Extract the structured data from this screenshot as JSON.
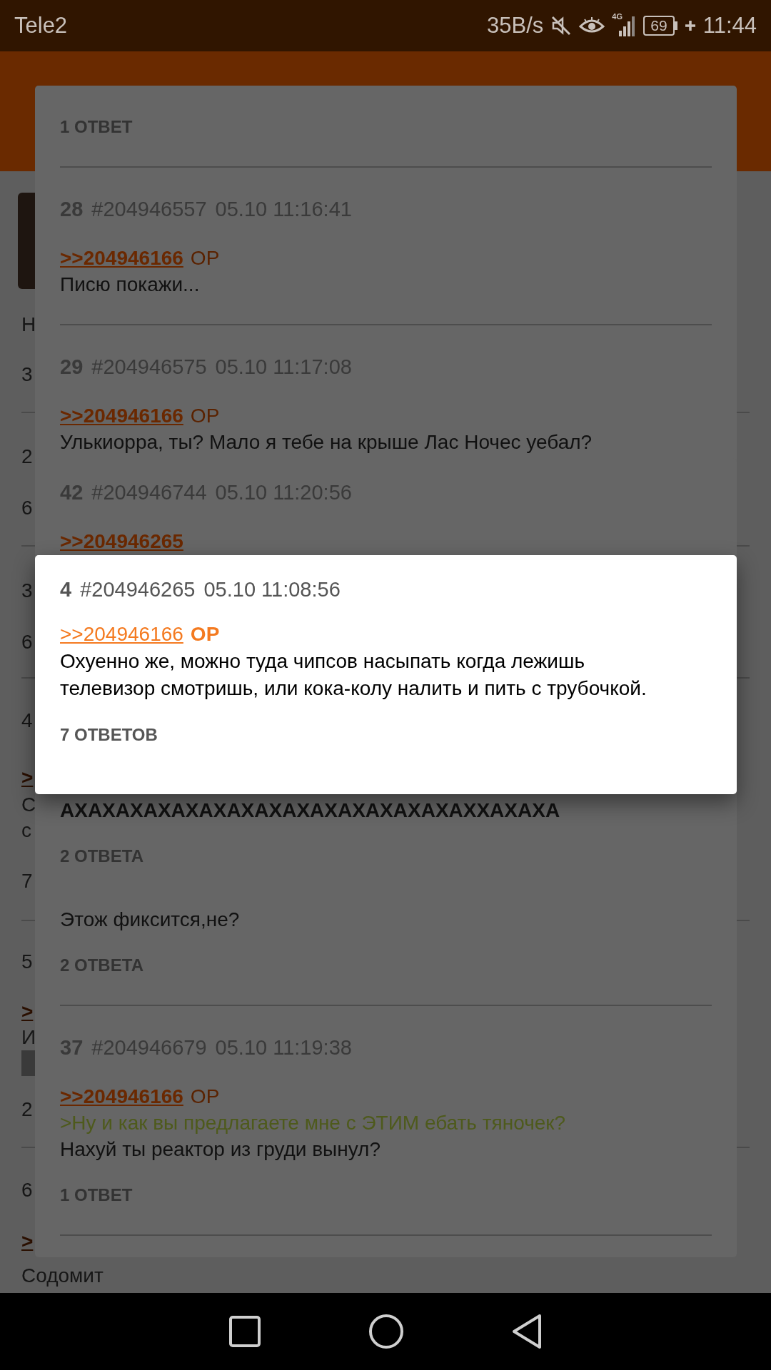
{
  "status_bar": {
    "carrier": "Tele2",
    "net_speed": "35B/s",
    "network": "4G",
    "battery": "69",
    "time": "11:44"
  },
  "background": {
    "rows": [
      {
        "kind": "thumbnail"
      },
      {
        "kind": "text",
        "text": "Н"
      },
      {
        "kind": "text",
        "text": "3"
      },
      {
        "kind": "divider"
      },
      {
        "kind": "text",
        "text": "2"
      },
      {
        "kind": "text",
        "text": "6"
      },
      {
        "kind": "divider"
      },
      {
        "kind": "text",
        "text": "3"
      },
      {
        "kind": "text",
        "text": "6"
      },
      {
        "kind": "divider"
      },
      {
        "kind": "text",
        "text": "4"
      },
      {
        "kind": "link",
        "text": ">"
      },
      {
        "kind": "text",
        "text": "С"
      },
      {
        "kind": "text",
        "text": "с"
      },
      {
        "kind": "text",
        "text": "7"
      },
      {
        "kind": "divider"
      },
      {
        "kind": "text",
        "text": "5"
      },
      {
        "kind": "link",
        "text": ">"
      },
      {
        "kind": "text",
        "text": "И"
      },
      {
        "kind": "spoiler"
      },
      {
        "kind": "text",
        "text": "2"
      },
      {
        "kind": "divider"
      },
      {
        "kind": "text",
        "text": "6"
      },
      {
        "kind": "link",
        "text": ">"
      },
      {
        "kind": "text",
        "text": "Содомит"
      }
    ]
  },
  "dialogs": [
    {
      "dimmed": true,
      "upper": [
        {
          "kind": "replies",
          "text": "1 ОТВЕТ"
        },
        {
          "kind": "divider"
        },
        {
          "kind": "post",
          "number": "28",
          "id": "#204946557",
          "date": "05.10 11:16:41",
          "link": ">>204946166",
          "op": "OP",
          "text": "Писю покажи..."
        },
        {
          "kind": "divider"
        },
        {
          "kind": "post",
          "number": "29",
          "id": "#204946575",
          "date": "05.10 11:17:08",
          "link": ">>204946166",
          "op": "OP",
          "text": "Улькиорра, ты? Мало я тебе на крыше Лас Ночес уебал?"
        }
      ],
      "lower": [
        {
          "kind": "text",
          "text": "Этож фиксится,не?"
        },
        {
          "kind": "replies",
          "text": "2 ОТВЕТА"
        },
        {
          "kind": "divider"
        },
        {
          "kind": "post",
          "number": "37",
          "id": "#204946679",
          "date": "05.10 11:19:38",
          "link": ">>204946166",
          "op": "OP",
          "quote": ">Ну и как вы предлагаете мне с ЭТИМ ебать тяночек?",
          "text": "Нахуй ты реактор из груди вынул?"
        },
        {
          "kind": "replies",
          "text": "1 ОТВЕТ"
        },
        {
          "kind": "divider"
        }
      ]
    },
    {
      "dimmed": true,
      "upper": [
        {
          "kind": "post",
          "number": "42",
          "id": "#204946744",
          "date": "05.10 11:20:56",
          "link": ">>204946265"
        }
      ],
      "lower": [
        {
          "kind": "bold_text",
          "text": "АХАХАХАХАХАХАХАХАХАХАХАХАХАХАХХАХАХА"
        },
        {
          "kind": "replies",
          "text": "2 ОТВЕТА"
        }
      ]
    },
    {
      "dimmed": false,
      "upper": [
        {
          "kind": "post",
          "number": "4",
          "id": "#204946265",
          "date": "05.10 11:08:56",
          "link": ">>204946166",
          "op": "OP",
          "text": "Охуенно же, можно туда чипсов насыпать когда лежишь телевизор смотришь, или кока-колу налить и пить с трубочкой."
        },
        {
          "kind": "replies",
          "text": "7 ОТВЕТОВ"
        }
      ]
    }
  ]
}
